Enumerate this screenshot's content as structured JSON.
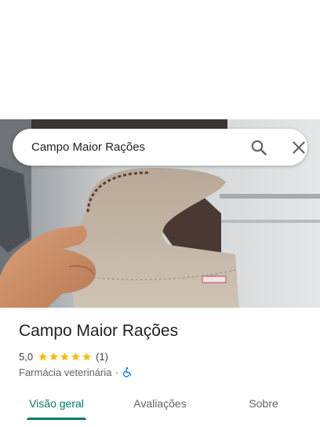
{
  "search": {
    "query": "Campo Maior Rações",
    "search_icon": "search-icon",
    "close_icon": "close-icon"
  },
  "hero": {
    "image": "photo of hand holding a beige suede glove"
  },
  "place": {
    "name": "Campo Maior Rações",
    "rating": "5,0",
    "stars_filled": 5,
    "star_color": "#fbbc04",
    "review_count": "(1)",
    "category": "Farmácia veterinária",
    "separator": "·",
    "accessibility_icon": "wheelchair-icon",
    "accessibility_color": "#1a73e8"
  },
  "tabs": [
    {
      "label": "Visão geral",
      "active": true
    },
    {
      "label": "Avaliações",
      "active": false
    },
    {
      "label": "Sobre",
      "active": false
    }
  ],
  "colors": {
    "accent": "#00796b",
    "text_primary": "#202124",
    "text_secondary": "#5f6368"
  }
}
